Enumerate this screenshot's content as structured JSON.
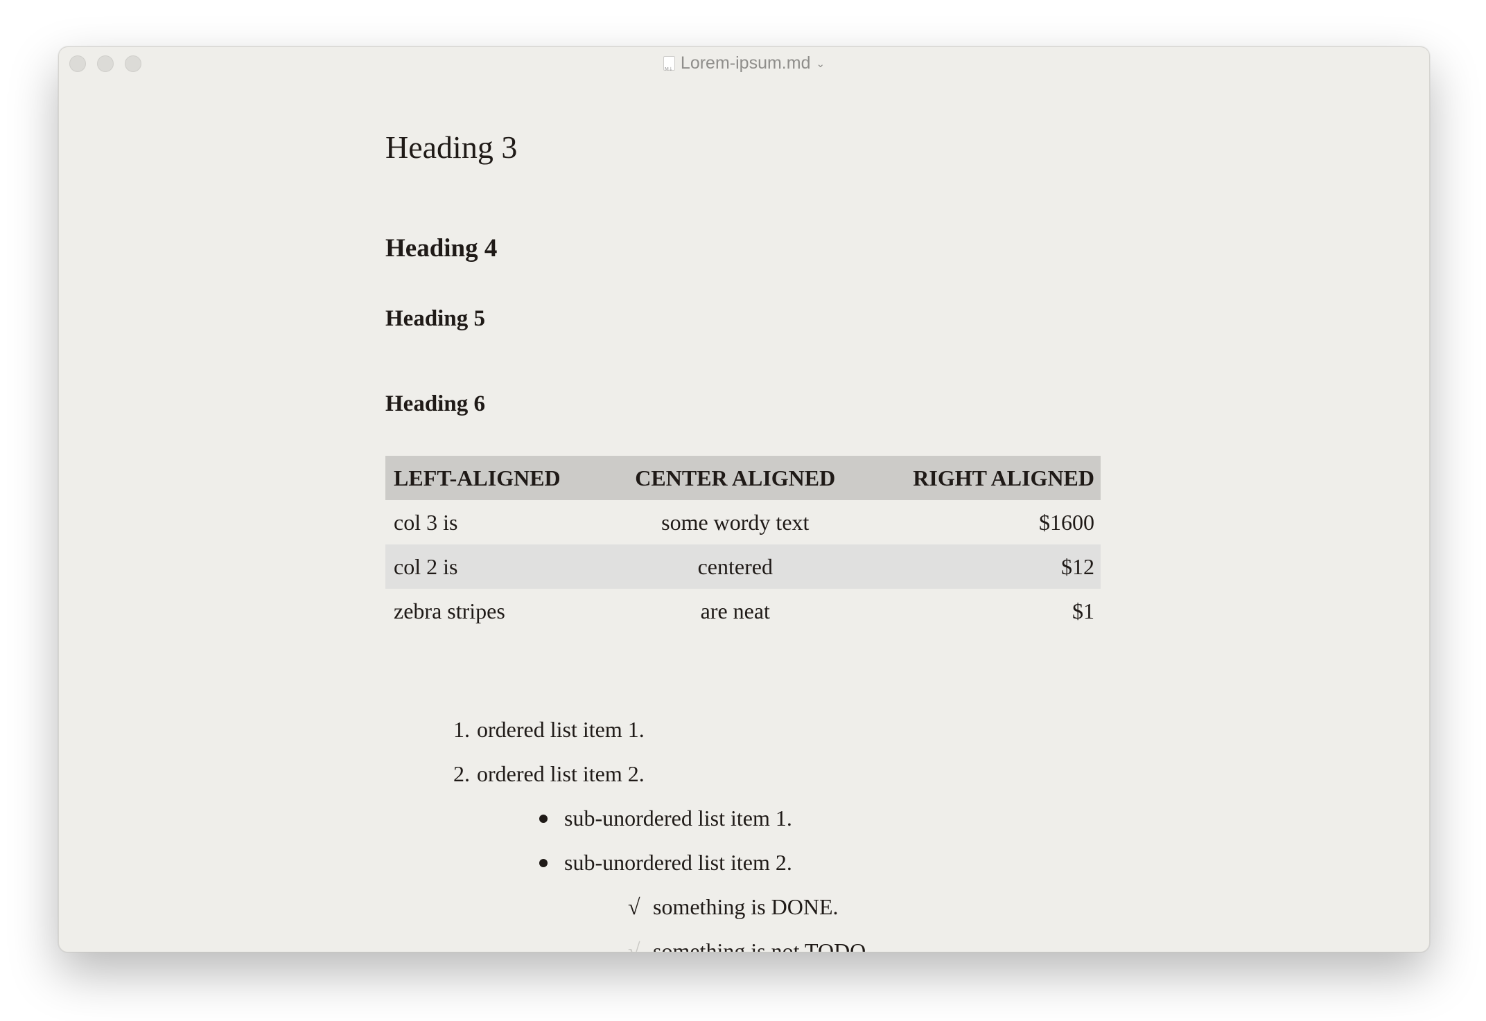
{
  "window": {
    "title": "Lorem-ipsum.md",
    "file_icon": "markdown-file-icon",
    "dropdown_icon": "chevron-down-icon"
  },
  "document": {
    "heading3": "Heading 3",
    "heading4": "Heading 4",
    "heading5": "Heading 5",
    "heading6": "Heading 6",
    "table": {
      "headers": [
        "LEFT-ALIGNED",
        "CENTER ALIGNED",
        "RIGHT ALIGNED"
      ],
      "rows": [
        [
          "col 3 is",
          "some wordy text",
          "$1600"
        ],
        [
          "col 2 is",
          "centered",
          "$12"
        ],
        [
          "zebra stripes",
          "are neat",
          "$1"
        ]
      ]
    },
    "ordered_list": [
      {
        "marker": "1.",
        "text": "ordered list item 1."
      },
      {
        "marker": "2.",
        "text": "ordered list item 2."
      }
    ],
    "unordered_list": [
      {
        "text": "sub-unordered list item 1."
      },
      {
        "text": "sub-unordered list item 2."
      }
    ],
    "task_list": [
      {
        "marker": "√",
        "text": "something is DONE.",
        "done": true
      },
      {
        "marker": "√",
        "text": "something is not TODO.",
        "done": false
      }
    ]
  },
  "colors": {
    "window_bg": "#efeeea",
    "text": "#1f1a17",
    "table_header_bg": "#cccbc8",
    "table_zebra_bg": "#e0e0df",
    "todo_check": "#c9c8c4"
  }
}
